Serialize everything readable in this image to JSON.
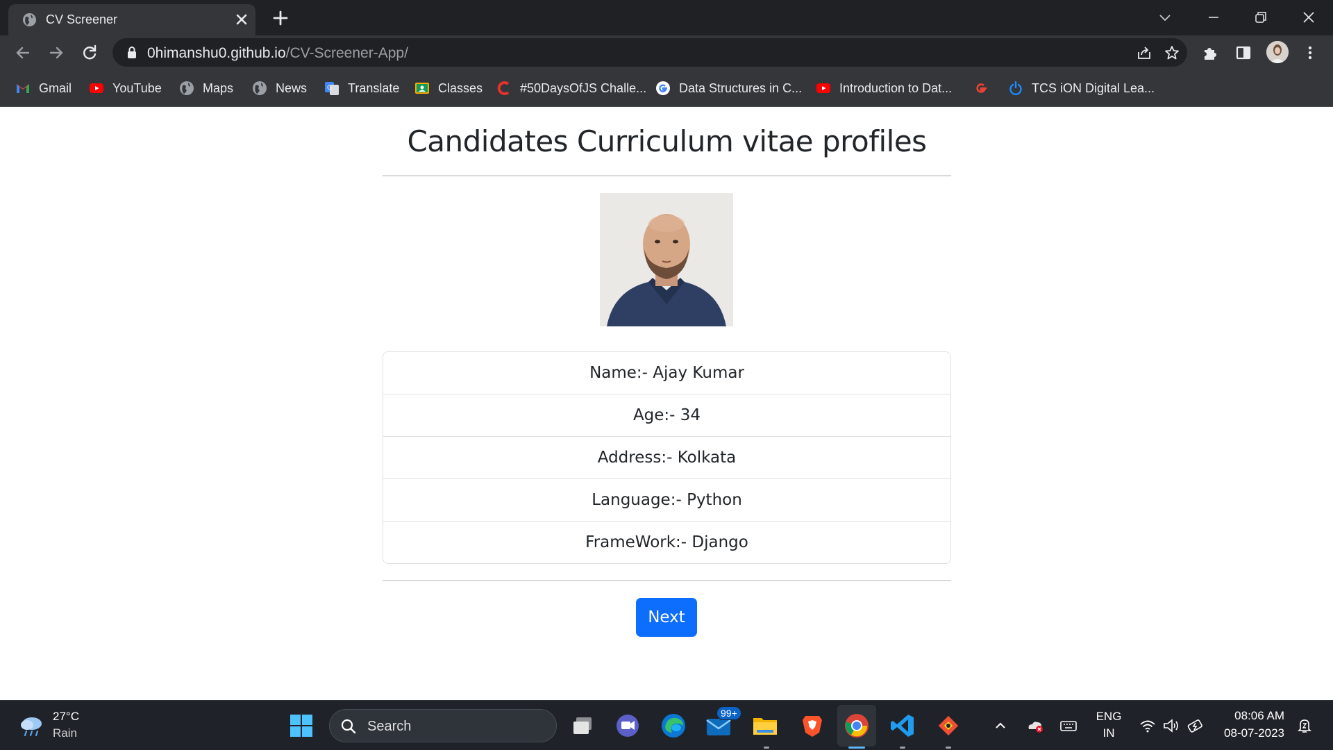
{
  "browser": {
    "tab_title": "CV Screener",
    "url_domain": "0himanshu0.github.io",
    "url_path": "/CV-Screener-App/",
    "bookmarks": [
      {
        "label": "Gmail",
        "icon": "gmail-icon"
      },
      {
        "label": "YouTube",
        "icon": "youtube-icon"
      },
      {
        "label": "Maps",
        "icon": "globe-icon"
      },
      {
        "label": "News",
        "icon": "globe-icon"
      },
      {
        "label": "Translate",
        "icon": "translate-icon"
      },
      {
        "label": "Classes",
        "icon": "classes-icon"
      },
      {
        "label": "#50DaysOfJS Challe...",
        "icon": "c-logo-icon"
      },
      {
        "label": "Data Structures in C...",
        "icon": "google-icon"
      },
      {
        "label": "Introduction to Dat...",
        "icon": "youtube-icon"
      },
      {
        "label": "",
        "icon": "google-icon"
      },
      {
        "label": "TCS iON Digital Lea...",
        "icon": "power-icon"
      }
    ]
  },
  "page": {
    "title": "Candidates Curriculum vitae profiles",
    "candidate": {
      "name": "Name:- Ajay Kumar",
      "age": "Age:- 34",
      "address": "Address:- Kolkata",
      "language": "Language:- Python",
      "framework": "FrameWork:- Django"
    },
    "next_label": "Next"
  },
  "taskbar": {
    "weather_temp": "27°C",
    "weather_cond": "Rain",
    "search_label": "Search",
    "mail_badge": "99+",
    "lang_top": "ENG",
    "lang_bottom": "IN",
    "time": "08:06 AM",
    "date": "08-07-2023"
  },
  "colors": {
    "primary_button": "#0d6efd",
    "chrome_dark": "#202124",
    "chrome_toolbar": "#35363a",
    "taskbar": "#1f2329"
  }
}
